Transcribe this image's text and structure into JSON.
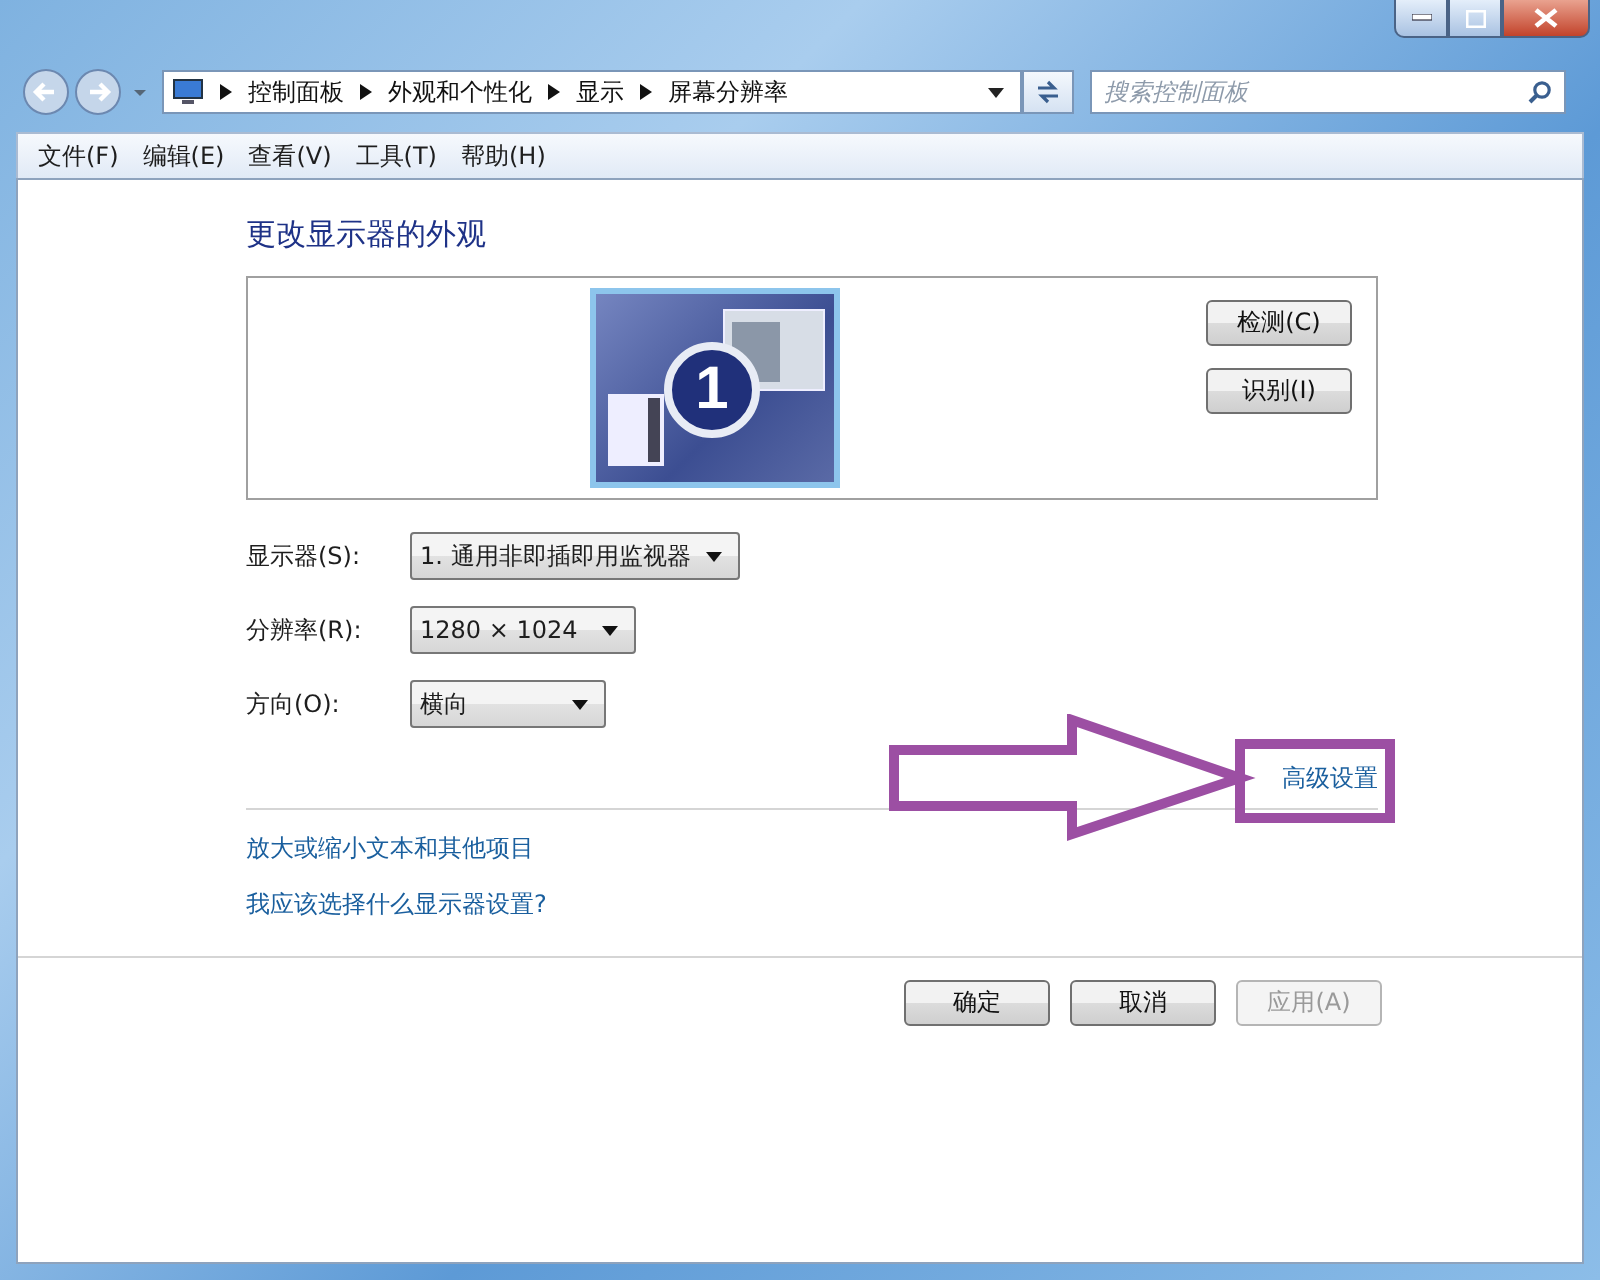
{
  "breadcrumb": [
    "控制面板",
    "外观和个性化",
    "显示",
    "屏幕分辨率"
  ],
  "search": {
    "placeholder": "搜索控制面板"
  },
  "menu": [
    "文件(F)",
    "编辑(E)",
    "查看(V)",
    "工具(T)",
    "帮助(H)"
  ],
  "heading": "更改显示器的外观",
  "monitor_preview": {
    "number": "1",
    "buttons": [
      "检测(C)",
      "识别(I)"
    ]
  },
  "settings": [
    {
      "label": "显示器(S):",
      "value": "1. 通用非即插即用监视器"
    },
    {
      "label": "分辨率(R):",
      "value": "1280 × 1024"
    },
    {
      "label": "方向(O):",
      "value": "横向"
    }
  ],
  "advanced_link": "高级设置",
  "links": [
    "放大或缩小文本和其他项目",
    "我应该选择什么显示器设置?"
  ],
  "buttons": [
    {
      "label": "确定",
      "disabled": false
    },
    {
      "label": "取消",
      "disabled": false
    },
    {
      "label": "应用(A)",
      "disabled": true
    }
  ]
}
